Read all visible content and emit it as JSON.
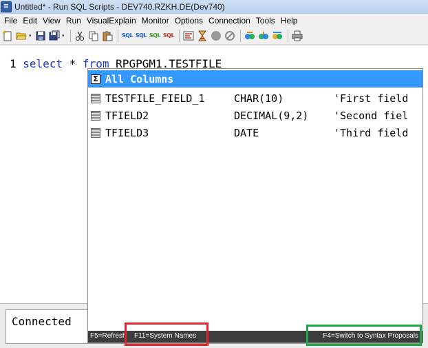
{
  "window": {
    "title": "Untitled* - Run SQL Scripts - DEV740.RZKH.DE(Dev740)"
  },
  "menu": [
    "File",
    "Edit",
    "View",
    "Run",
    "VisualExplain",
    "Monitor",
    "Options",
    "Connection",
    "Tools",
    "Help"
  ],
  "toolbar": {
    "icons": [
      "new-script-icon",
      "open-icon",
      "save-icon",
      "save-as-icon",
      "cut-icon",
      "copy-icon",
      "paste-icon",
      "run-sql-icon",
      "run-all-sql-icon",
      "run-selected-sql-icon",
      "run-from-selected-sql-icon",
      "explain-icon",
      "run-and-explain-icon",
      "stop-icon",
      "cancel-icon",
      "job-log-icon",
      "print-icon"
    ],
    "sql_label": "SQL"
  },
  "editor": {
    "line_number": "1",
    "keyword_select": "select",
    "star": "*",
    "keyword_from": "from",
    "table": "RPGPGM1.TESTFILE"
  },
  "autocomplete": {
    "selected_label": "All Columns",
    "sigma_glyph": "Σ",
    "columns": [
      {
        "name": "TESTFILE_FIELD_1",
        "type": "CHAR(10)",
        "description": "'First field"
      },
      {
        "name": "TFIELD2",
        "type": "DECIMAL(9,2)",
        "description": "'Second fiel"
      },
      {
        "name": "TFIELD3",
        "type": "DATE",
        "description": "'Third field"
      }
    ],
    "hints": {
      "refresh": "F5=Refresh",
      "system_names": "F11=System Names",
      "syntax": "F4=Switch to Syntax Proposals"
    }
  },
  "messages": {
    "status": "Connected"
  },
  "colors": {
    "selection": "#3399ff",
    "keyword": "#1f36c8",
    "highlight_red": "#e3262d",
    "highlight_green": "#1ba84a"
  }
}
